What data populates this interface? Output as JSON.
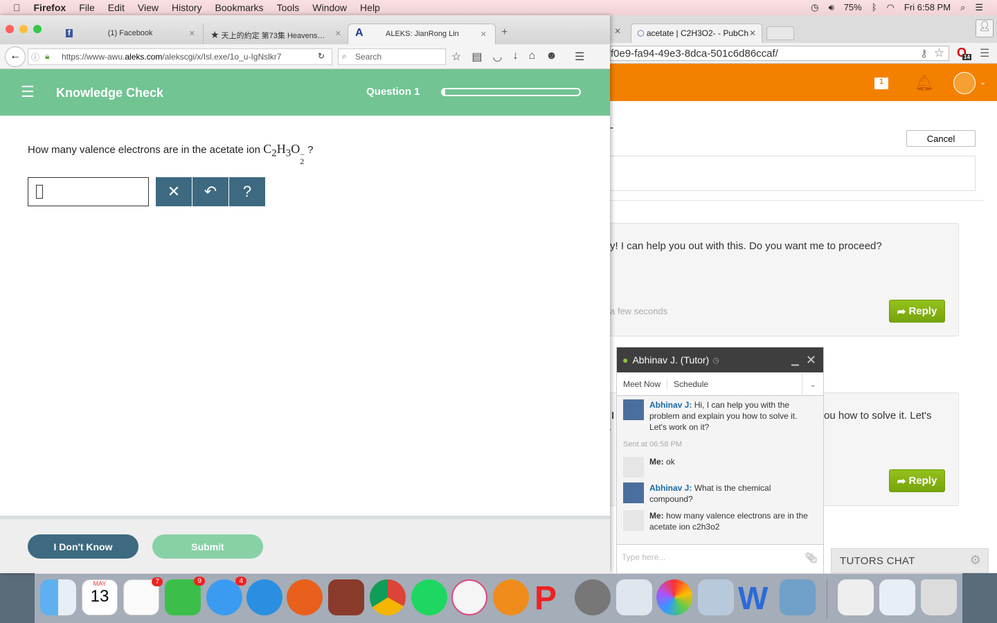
{
  "menubar": {
    "app": "Firefox",
    "items": [
      "File",
      "Edit",
      "View",
      "History",
      "Bookmarks",
      "Tools",
      "Window",
      "Help"
    ],
    "battery": "75%",
    "clock": "Fri 6:58 PM"
  },
  "firefox": {
    "tabs": [
      {
        "label": "(1) Facebook",
        "icon": "facebook-icon"
      },
      {
        "label": "天上的約定 第73集 Heavens…",
        "icon": "star-icon"
      },
      {
        "label": "ALEKS: JianRong Lin",
        "icon": "aleks-icon",
        "active": true
      }
    ],
    "url_prefix": "https://www-awu.",
    "url_domain": "aleks.com",
    "url_rest": "/alekscgi/x/Isl.exe/1o_u-IgNslkr7",
    "search_placeholder": "Search"
  },
  "aleks": {
    "title": "Knowledge Check",
    "question_label": "Question 1",
    "progress": 0.02,
    "question_text": "How many valence electrons are in the acetate ion",
    "formula": {
      "c": "C",
      "c_n": "2",
      "h": "H",
      "h_n": "3",
      "o": "O",
      "o_n": "2",
      "charge": "−"
    },
    "question_end": "?",
    "answer_value": "",
    "tools": {
      "clear": "✕",
      "undo": "↶",
      "help": "?"
    },
    "dont_know": "I Don't Know",
    "submit": "Submit",
    "colors": {
      "header": "#72c493",
      "tool": "#3d6a80"
    }
  },
  "chrome": {
    "tab": "acetate | C2H3O2- - PubCh",
    "url": "f0e9-fa94-49e3-8dca-501c6d86ccaf/",
    "ext_badge": "14",
    "message_count": "1",
    "page": {
      "heading_fragment": "-",
      "cancel": "Cancel",
      "post1": "y! I can help you out with this. Do you want me to proceed?",
      "post1_time": "a few seconds",
      "reply": "Reply",
      "post2": "ou how to solve it. Let's",
      "post2_left1": "I",
      "post2_left2": "r"
    },
    "accent": "#f48000"
  },
  "chat": {
    "title": "Abhinav J. (Tutor)",
    "meet_now": "Meet Now",
    "schedule": "Schedule",
    "messages": [
      {
        "from": "Abhinav J:",
        "text": "Hi, I can help you with the problem and explain you how to solve it. Let's work on it?"
      },
      {
        "from": "Me:",
        "text": "ok"
      },
      {
        "from": "Abhinav J:",
        "text": "What is the chemical compound?"
      },
      {
        "from": "Me:",
        "text": "how many valence electrons are in the acetate ion c2h3o2"
      }
    ],
    "sent_at": "Sent at 06:58 PM",
    "input_placeholder": "Type here...",
    "tutors_chat": "TUTORS CHAT"
  },
  "dock": {
    "calendar_month": "MAY",
    "calendar_day": "13",
    "badges": {
      "reminders": "7",
      "facetime": "9",
      "messages": "4"
    }
  }
}
